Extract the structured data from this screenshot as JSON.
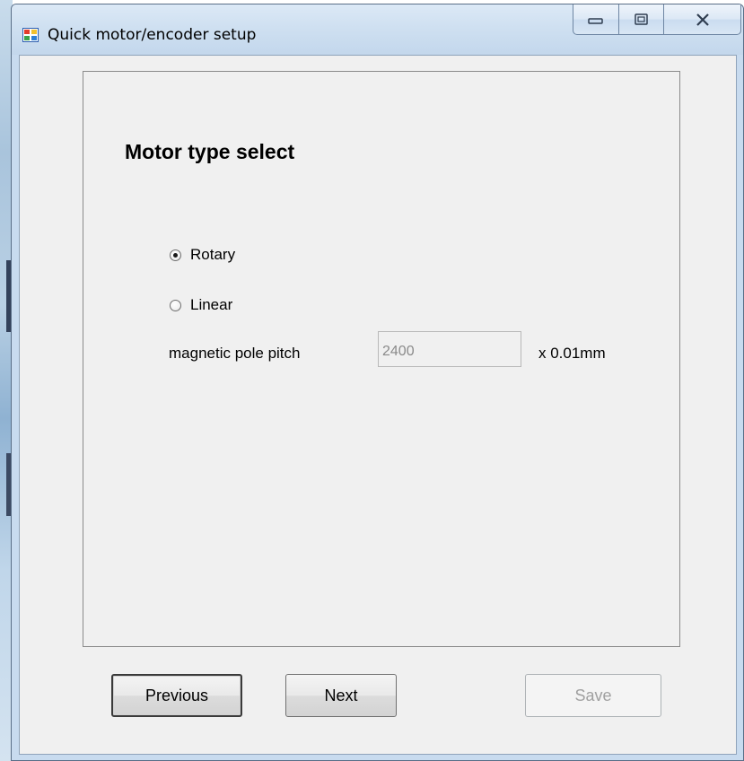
{
  "window": {
    "title": "Quick motor/encoder setup",
    "icon": "app-window-icon",
    "caption_buttons": [
      "minimize-icon",
      "maximize-icon",
      "close-icon"
    ]
  },
  "panel": {
    "heading": "Motor type select",
    "options": [
      {
        "label": "Rotary",
        "selected": true
      },
      {
        "label": "Linear",
        "selected": false
      }
    ],
    "pitch": {
      "label": "magnetic pole pitch",
      "value": "2400",
      "unit": "x 0.01mm",
      "enabled": false
    }
  },
  "buttons": {
    "previous": "Previous",
    "next": "Next",
    "save": "Save"
  },
  "colors": {
    "titlebar": "#cfe0f1",
    "client_background": "#f0f0f0",
    "disabled_text": "#a0a0a0"
  }
}
